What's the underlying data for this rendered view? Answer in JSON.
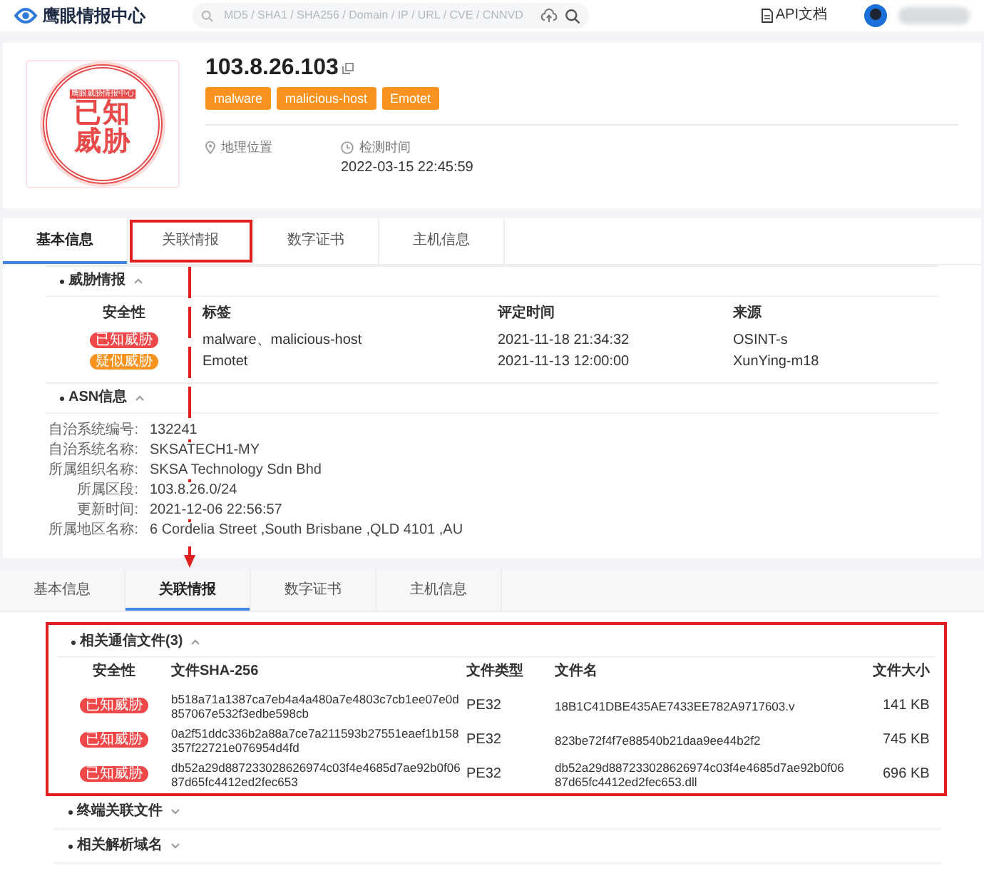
{
  "header": {
    "logo": "鹰眼情报中心",
    "search_placeholder": "MD5 / SHA1 / SHA256 / Domain / IP / URL / CVE / CNNVD",
    "api_link": "API文档"
  },
  "summary": {
    "stamp_ring": "鹰眼威胁情报中心",
    "stamp_line1": "已知",
    "stamp_line2": "威胁",
    "ip": "103.8.26.103",
    "tags": [
      "malware",
      "malicious-host",
      "Emotet"
    ],
    "location_label": "地理位置",
    "detect_label": "检测时间",
    "detect_time": "2022-03-15 22:45:59"
  },
  "tabs": [
    {
      "label": "基本信息",
      "selected": true,
      "highlighted": false
    },
    {
      "label": "关联情报",
      "selected": false,
      "highlighted": true
    },
    {
      "label": "数字证书",
      "selected": false,
      "highlighted": false
    },
    {
      "label": "主机信息",
      "selected": false,
      "highlighted": false
    }
  ],
  "threat": {
    "title": "威胁情报",
    "expanded": true,
    "columns": [
      "安全性",
      "标签",
      "评定时间",
      "来源"
    ],
    "rows": [
      {
        "verdict": "已知威胁",
        "color": "#f04848",
        "tags": "malware、malicious-host",
        "time": "2021-11-18 21:34:32",
        "source": "OSINT-s"
      },
      {
        "verdict": "疑似威胁",
        "color": "#f7931e",
        "tags": "Emotet",
        "time": "2021-11-13 12:00:00",
        "source": "XunYing-m18"
      }
    ]
  },
  "asn": {
    "title": "ASN信息",
    "expanded": true,
    "fields": [
      {
        "label": "自治系统编号:",
        "value": "132241"
      },
      {
        "label": "自治系统名称:",
        "value": "SKSATECH1-MY"
      },
      {
        "label": "所属组织名称:",
        "value": "SKSA Technology Sdn Bhd"
      },
      {
        "label": "所属区段:",
        "value": "103.8.26.0/24"
      },
      {
        "label": "更新时间:",
        "value": "2021-12-06 22:56:57"
      },
      {
        "label": "所属地区名称:",
        "value": "6 Cordelia Street ,South Brisbane ,QLD 4101 ,AU"
      }
    ]
  },
  "tabs_second": [
    {
      "label": "基本信息",
      "selected": false
    },
    {
      "label": "关联情报",
      "selected": true
    },
    {
      "label": "数字证书",
      "selected": false
    },
    {
      "label": "主机信息",
      "selected": false
    }
  ],
  "files": {
    "title": "相关通信文件(3)",
    "expanded": true,
    "highlighted": true,
    "columns": [
      "安全性",
      "文件SHA-256",
      "文件类型",
      "文件名",
      "文件大小"
    ],
    "rows": [
      {
        "verdict": "已知威胁",
        "color": "#f04848",
        "sha": [
          "b518a71a1387ca7eb4a4a480a7e4803c7cb1ee07e0d",
          "857067e532f3edbe598cb"
        ],
        "type": "PE32",
        "name": [
          "18B1C41DBE435AE7433EE782A9717603.v"
        ],
        "size": "141 KB"
      },
      {
        "verdict": "已知威胁",
        "color": "#f04848",
        "sha": [
          "0a2f51ddc336b2a88a7ce7a211593b27551eaef1b158",
          "357f22721e076954d4fd"
        ],
        "type": "PE32",
        "name": [
          "823be72f4f7e88540b21daa9ee44b2f2"
        ],
        "size": "745 KB"
      },
      {
        "verdict": "已知威胁",
        "color": "#f04848",
        "sha": [
          "db52a29d887233028626974c03f4e4685d7ae92b0f06",
          "87d65fc4412ed2fec653"
        ],
        "type": "PE32",
        "name": [
          "db52a29d887233028626974c03f4e4685d7ae92b0f06",
          "87d65fc4412ed2fec653.dll"
        ],
        "size": "696 KB"
      }
    ]
  },
  "more_sections": [
    {
      "title": "终端关联文件",
      "expanded": false
    },
    {
      "title": "相关解析域名",
      "expanded": false
    }
  ]
}
